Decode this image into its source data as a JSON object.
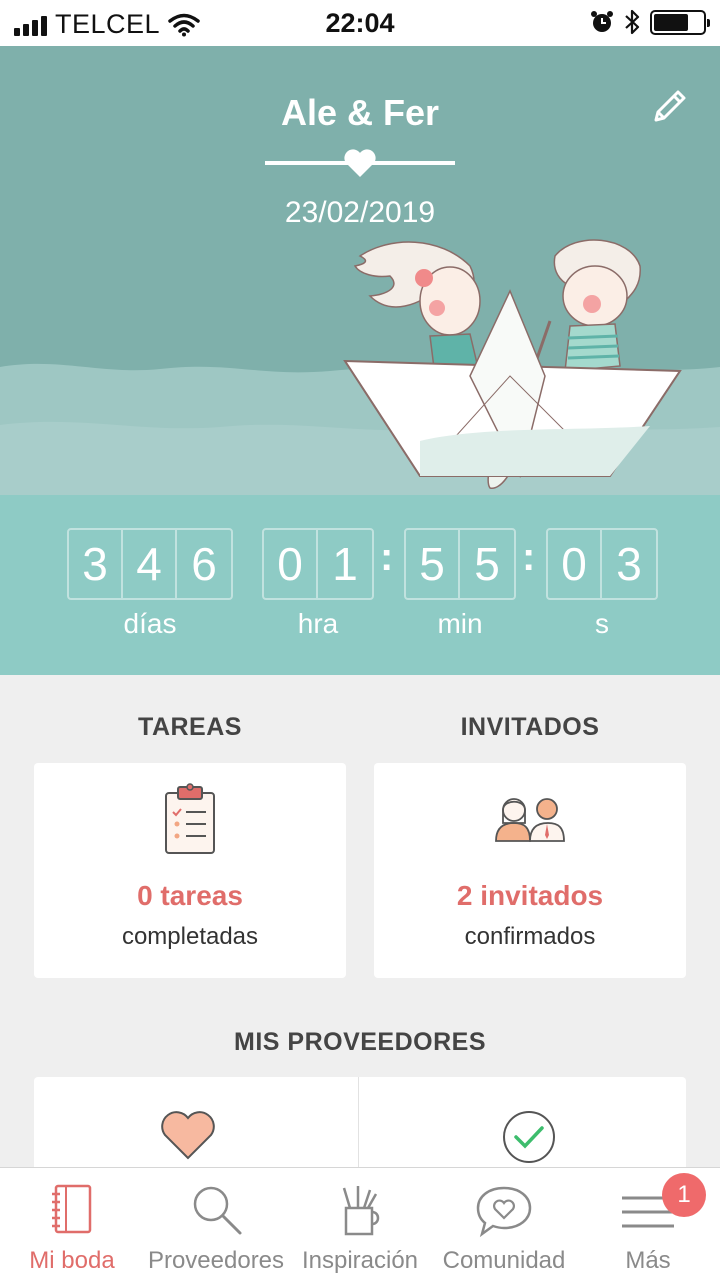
{
  "status_bar": {
    "carrier": "TELCEL",
    "time": "22:04"
  },
  "hero": {
    "title": "Ale & Fer",
    "date": "23/02/2019"
  },
  "countdown": {
    "days": [
      "3",
      "4",
      "6"
    ],
    "hours": [
      "0",
      "1"
    ],
    "minutes": [
      "5",
      "5"
    ],
    "seconds": [
      "0",
      "3"
    ],
    "separator": ":",
    "labels": {
      "days": "días",
      "hours": "hra",
      "minutes": "min",
      "seconds": "s"
    }
  },
  "tasks": {
    "heading": "TAREAS",
    "count": "0 tareas",
    "caption": "completadas"
  },
  "guests": {
    "heading": "INVITADOS",
    "count": "2 invitados",
    "caption": "confirmados"
  },
  "providers": {
    "heading": "MIS PROVEEDORES"
  },
  "tabbar": {
    "tabs": [
      {
        "label": "Mi boda",
        "icon": "notebook-icon",
        "active": true
      },
      {
        "label": "Proveedores",
        "icon": "search-icon",
        "active": false
      },
      {
        "label": "Inspiración",
        "icon": "pencil-cup-icon",
        "active": false
      },
      {
        "label": "Comunidad",
        "icon": "chat-heart-icon",
        "active": false
      },
      {
        "label": "Más",
        "icon": "menu-icon",
        "active": false
      }
    ],
    "more_badge": "1"
  },
  "colors": {
    "hero_bg": "#7fb0ab",
    "countdown_bg": "#8ecbc5",
    "accent": "#e06d6a",
    "badge": "#ef6a6b",
    "page_bg": "#efefef"
  }
}
